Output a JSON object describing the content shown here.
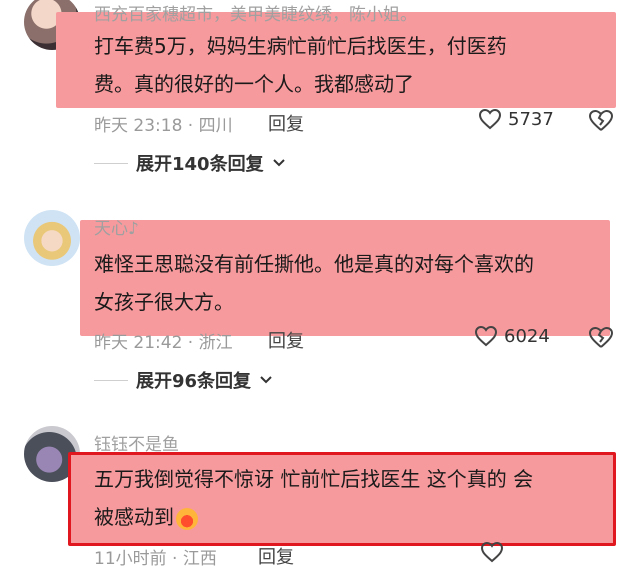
{
  "comments": [
    {
      "username": "西充百家穗超市，美甲美睫纹绣，陈小姐。",
      "text_line1": "打车费5万，妈妈生病忙前忙后找医生，付医药",
      "text_line2": "费。真的很好的一个人。我都感动了",
      "time_location": "昨天 23:18 · 四川",
      "reply_label": "回复",
      "likes": "5737",
      "expand_label": "展开140条回复"
    },
    {
      "username": "天心♪",
      "text_line1": "难怪王思聪没有前任撕他。他是真的对每个喜欢的",
      "text_line2": "女孩子很大方。",
      "time_location": "昨天 21:42 · 浙江",
      "reply_label": "回复",
      "likes": "6024",
      "expand_label": "展开96条回复"
    },
    {
      "username": "钰钰不是鱼",
      "text_line1": "五万我倒觉得不惊讶 忙前忙后找医生 这个真的 会",
      "text_line2": "被感动到",
      "time_location": "11小时前 · 江西",
      "reply_label": "回复"
    }
  ],
  "icons": {
    "heart": "heart-icon",
    "broken_heart": "broken-heart-icon",
    "chevron": "chevron-down-icon",
    "emoji": "crying-laughing-emoji"
  },
  "colors": {
    "highlight": "#f79a9d",
    "highlight_border": "#e0171e",
    "meta_text": "#9a9a9a"
  }
}
